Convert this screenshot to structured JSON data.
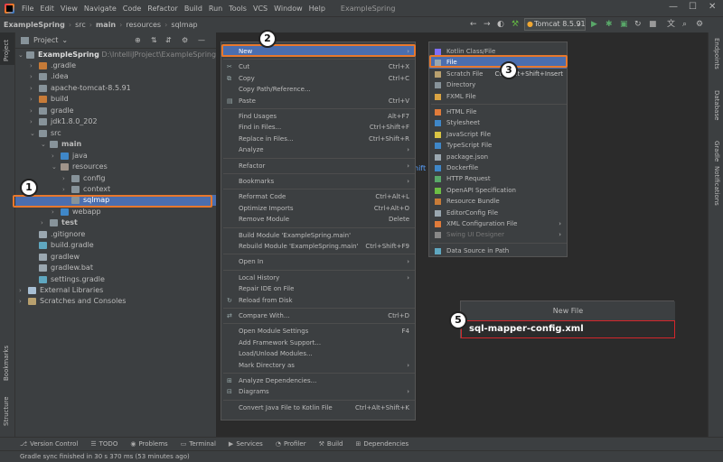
{
  "menubar": {
    "items": [
      "File",
      "Edit",
      "View",
      "Navigate",
      "Code",
      "Refactor",
      "Build",
      "Run",
      "Tools",
      "VCS",
      "Window",
      "Help"
    ],
    "project_title": "ExampleSpring"
  },
  "navbar": {
    "crumbs": [
      "ExampleSpring",
      "src",
      "main",
      "resources",
      "sqlmap"
    ],
    "run_config": "Tomcat 8.5.91"
  },
  "project_panel": {
    "title": "Project",
    "root_label": "ExampleSpring",
    "root_path": "D:\\IntelliJProject\\ExampleSpring",
    "tree": [
      {
        "label": ".gradle",
        "depth": 1,
        "arrow": "›",
        "icon": "folder-orange"
      },
      {
        "label": ".idea",
        "depth": 1,
        "arrow": "›",
        "icon": "folder"
      },
      {
        "label": "apache-tomcat-8.5.91",
        "depth": 1,
        "arrow": "›",
        "icon": "folder"
      },
      {
        "label": "build",
        "depth": 1,
        "arrow": "›",
        "icon": "folder-orange"
      },
      {
        "label": "gradle",
        "depth": 1,
        "arrow": "›",
        "icon": "folder"
      },
      {
        "label": "jdk1.8.0_202",
        "depth": 1,
        "arrow": "›",
        "icon": "folder"
      },
      {
        "label": "src",
        "depth": 1,
        "arrow": "⌄",
        "icon": "folder"
      },
      {
        "label": "main",
        "depth": 2,
        "arrow": "⌄",
        "icon": "folder",
        "bold": true
      },
      {
        "label": "java",
        "depth": 3,
        "arrow": "›",
        "icon": "folder-blue"
      },
      {
        "label": "resources",
        "depth": 3,
        "arrow": "⌄",
        "icon": "folder-res"
      },
      {
        "label": "config",
        "depth": 4,
        "arrow": "›",
        "icon": "folder"
      },
      {
        "label": "context",
        "depth": 4,
        "arrow": "›",
        "icon": "folder"
      },
      {
        "label": "sqlmap",
        "depth": 4,
        "arrow": "",
        "icon": "folder",
        "selected": true
      },
      {
        "label": "webapp",
        "depth": 3,
        "arrow": "›",
        "icon": "folder-blue"
      },
      {
        "label": "test",
        "depth": 2,
        "arrow": "›",
        "icon": "folder",
        "bold": true
      },
      {
        "label": ".gitignore",
        "depth": 1,
        "arrow": "",
        "icon": "file"
      },
      {
        "label": "build.gradle",
        "depth": 1,
        "arrow": "",
        "icon": "file-gradle"
      },
      {
        "label": "gradlew",
        "depth": 1,
        "arrow": "",
        "icon": "file"
      },
      {
        "label": "gradlew.bat",
        "depth": 1,
        "arrow": "",
        "icon": "file"
      },
      {
        "label": "settings.gradle",
        "depth": 1,
        "arrow": "",
        "icon": "file-gradle"
      },
      {
        "label": "External Libraries",
        "depth": 0,
        "arrow": "›",
        "icon": "lib"
      },
      {
        "label": "Scratches and Consoles",
        "depth": 0,
        "arrow": "›",
        "icon": "scratch"
      }
    ]
  },
  "context_menu": {
    "items": [
      {
        "label": "New",
        "shortcut": "",
        "sub": true,
        "highlight": true
      },
      {
        "sep": true
      },
      {
        "label": "Cut",
        "shortcut": "Ctrl+X",
        "icon": "cut"
      },
      {
        "label": "Copy",
        "shortcut": "Ctrl+C",
        "icon": "copy"
      },
      {
        "label": "Copy Path/Reference...",
        "shortcut": ""
      },
      {
        "label": "Paste",
        "shortcut": "Ctrl+V",
        "icon": "paste"
      },
      {
        "sep": true
      },
      {
        "label": "Find Usages",
        "shortcut": "Alt+F7"
      },
      {
        "label": "Find in Files...",
        "shortcut": "Ctrl+Shift+F"
      },
      {
        "label": "Replace in Files...",
        "shortcut": "Ctrl+Shift+R"
      },
      {
        "label": "Analyze",
        "shortcut": "",
        "sub": true
      },
      {
        "sep": true
      },
      {
        "label": "Refactor",
        "shortcut": "",
        "sub": true
      },
      {
        "sep": true
      },
      {
        "label": "Bookmarks",
        "shortcut": "",
        "sub": true
      },
      {
        "sep": true
      },
      {
        "label": "Reformat Code",
        "shortcut": "Ctrl+Alt+L"
      },
      {
        "label": "Optimize Imports",
        "shortcut": "Ctrl+Alt+O"
      },
      {
        "label": "Remove Module",
        "shortcut": "Delete"
      },
      {
        "sep": true
      },
      {
        "label": "Build Module 'ExampleSpring.main'",
        "shortcut": ""
      },
      {
        "label": "Rebuild Module 'ExampleSpring.main'",
        "shortcut": "Ctrl+Shift+F9"
      },
      {
        "sep": true
      },
      {
        "label": "Open In",
        "shortcut": "",
        "sub": true
      },
      {
        "sep": true
      },
      {
        "label": "Local History",
        "shortcut": "",
        "sub": true
      },
      {
        "label": "Repair IDE on File",
        "shortcut": ""
      },
      {
        "label": "Reload from Disk",
        "shortcut": "",
        "icon": "reload"
      },
      {
        "sep": true
      },
      {
        "label": "Compare With...",
        "shortcut": "Ctrl+D",
        "icon": "compare"
      },
      {
        "sep": true
      },
      {
        "label": "Open Module Settings",
        "shortcut": "F4"
      },
      {
        "label": "Add Framework Support...",
        "shortcut": ""
      },
      {
        "label": "Load/Unload Modules...",
        "shortcut": ""
      },
      {
        "label": "Mark Directory as",
        "shortcut": "",
        "sub": true
      },
      {
        "sep": true
      },
      {
        "label": "Analyze Dependencies...",
        "shortcut": "",
        "icon": "analyze"
      },
      {
        "label": "Diagrams",
        "shortcut": "",
        "sub": true,
        "icon": "diagram"
      },
      {
        "sep": true
      },
      {
        "label": "Convert Java File to Kotlin File",
        "shortcut": "Ctrl+Alt+Shift+K"
      }
    ]
  },
  "submenu": {
    "items": [
      {
        "label": "Kotlin Class/File",
        "icon": "kotlin"
      },
      {
        "label": "File",
        "icon": "file",
        "highlight": true
      },
      {
        "label": "Scratch File",
        "shortcut": "Ctrl+Alt+Shift+Insert",
        "icon": "scratch"
      },
      {
        "label": "Directory",
        "icon": "folder"
      },
      {
        "label": "FXML File",
        "icon": "fxml"
      },
      {
        "sep": true
      },
      {
        "label": "HTML File",
        "icon": "html"
      },
      {
        "label": "Stylesheet",
        "icon": "css"
      },
      {
        "label": "JavaScript File",
        "icon": "js"
      },
      {
        "label": "TypeScript File",
        "icon": "ts"
      },
      {
        "label": "package.json",
        "icon": "json"
      },
      {
        "label": "Dockerfile",
        "icon": "docker"
      },
      {
        "label": "HTTP Request",
        "icon": "http"
      },
      {
        "label": "OpenAPI Specification",
        "icon": "openapi"
      },
      {
        "label": "Resource Bundle",
        "icon": "bundle"
      },
      {
        "label": "EditorConfig File",
        "icon": "editorconfig"
      },
      {
        "label": "XML Configuration File",
        "sub": true,
        "icon": "xml"
      },
      {
        "label": "Swing UI Designer",
        "sub": true,
        "disabled": true,
        "icon": "swing"
      },
      {
        "sep": true
      },
      {
        "label": "Data Source in Path",
        "icon": "db"
      }
    ]
  },
  "dialog": {
    "title": "New File",
    "input_value": "sql-mapper-config.xml"
  },
  "editor_hint": "hift",
  "badges": [
    "1",
    "2",
    "3",
    "5"
  ],
  "side_tools": {
    "left": [
      "Project",
      "Bookmarks",
      "Structure"
    ],
    "right": [
      "Endpoints",
      "Database",
      "Gradle",
      "Notifications"
    ]
  },
  "bottom_tools": [
    "Version Control",
    "TODO",
    "Problems",
    "Terminal",
    "Services",
    "Profiler",
    "Build",
    "Dependencies"
  ],
  "status_text": "Gradle sync finished in 30 s 370 ms (53 minutes ago)",
  "colors": {
    "accent": "#4b6eaf",
    "annotation_orange": "#e8782c",
    "annotation_red": "#d4262b"
  }
}
